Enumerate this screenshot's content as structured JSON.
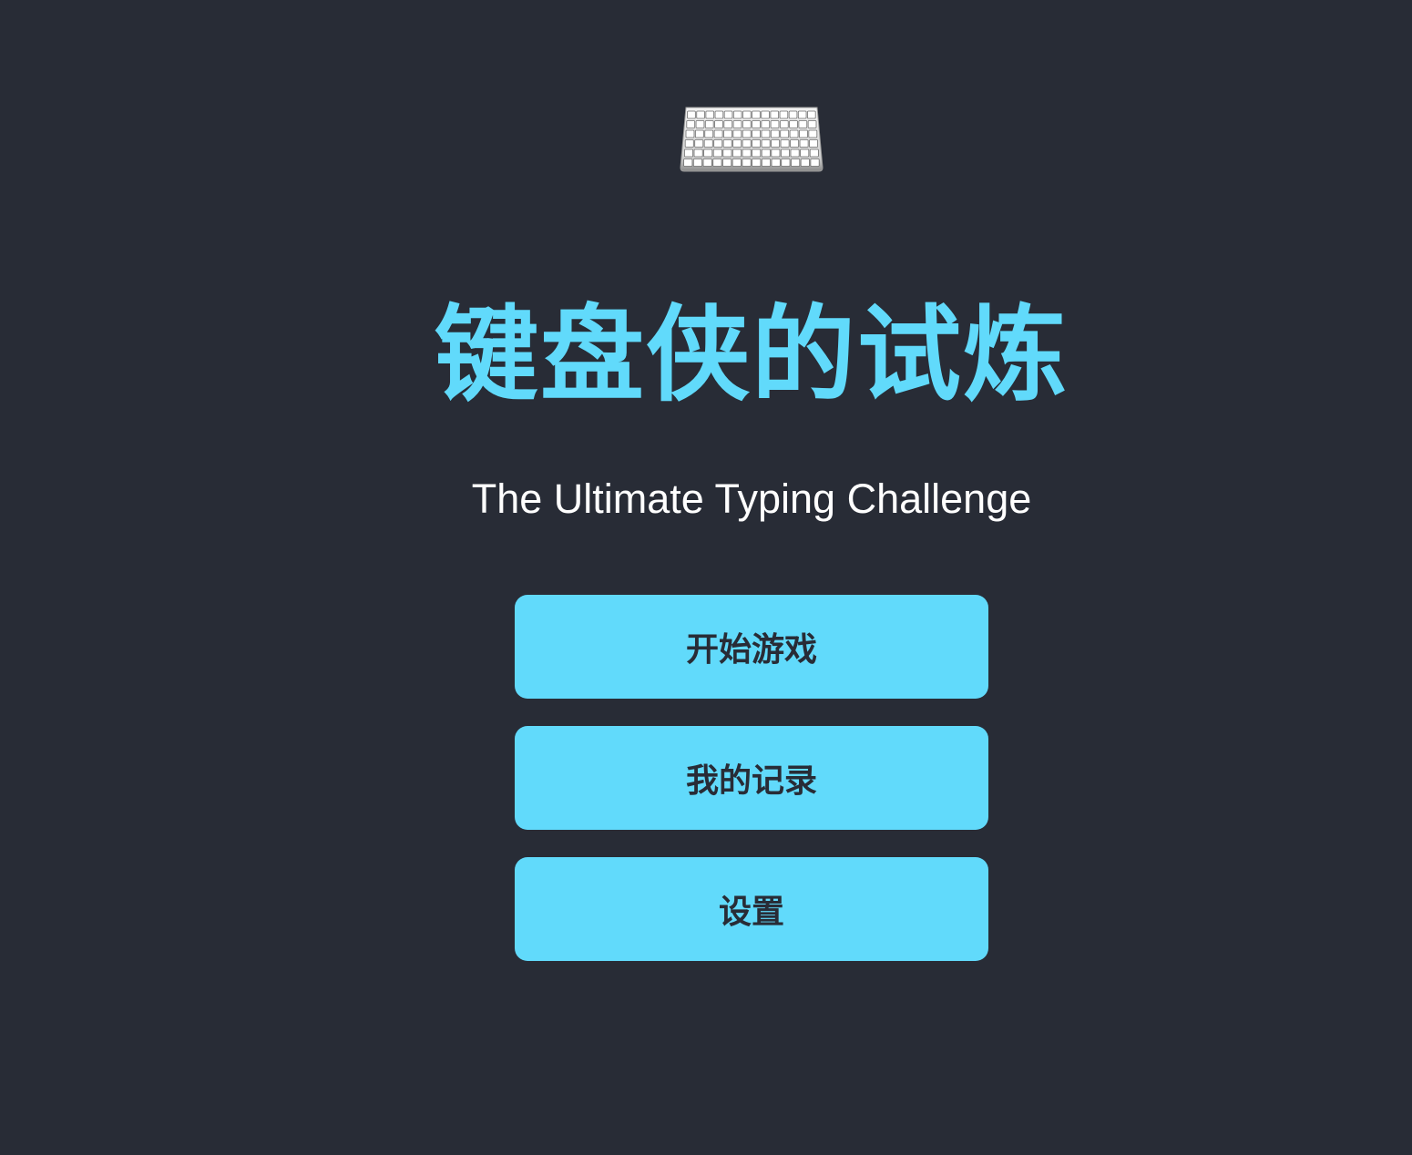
{
  "app": {
    "logo_icon": "keyboard-icon",
    "title": "键盘侠的试炼",
    "subtitle": "The Ultimate Typing Challenge"
  },
  "menu": {
    "start_label": "开始游戏",
    "records_label": "我的记录",
    "settings_label": "设置"
  },
  "colors": {
    "background": "#282c36",
    "accent": "#61dafb",
    "button_text": "#282c36",
    "subtitle_text": "#ffffff"
  }
}
